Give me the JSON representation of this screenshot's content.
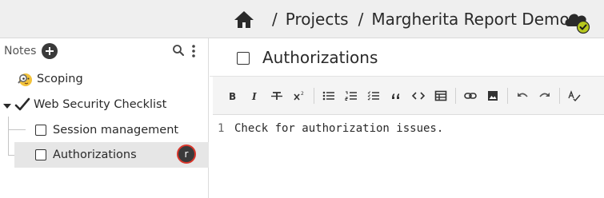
{
  "header": {
    "breadcrumb_sep": "/",
    "breadcrumbs": [
      {
        "label": "Projects"
      },
      {
        "label": "Margherita Report Demo"
      }
    ],
    "sync_status_icon": "cloud-check-icon"
  },
  "sidebar": {
    "title": "Notes",
    "items": [
      {
        "label": "Scoping",
        "icon": "magnifier-emoji-icon"
      },
      {
        "label": "Web Security Checklist",
        "icon": "checkmark-icon",
        "expanded": true
      },
      {
        "label": "Session management",
        "checked": false
      },
      {
        "label": "Authorizations",
        "checked": false,
        "selected": true,
        "user_badge": "r"
      }
    ]
  },
  "note": {
    "title": "Authorizations",
    "checked": false
  },
  "toolbar": {
    "buttons": [
      "bold",
      "italic",
      "strikethrough",
      "superscript",
      "bullet-list",
      "numbered-list",
      "task-list",
      "quote",
      "code",
      "table",
      "link",
      "image",
      "undo",
      "redo",
      "spellcheck"
    ]
  },
  "editor": {
    "lines": [
      {
        "number": "1",
        "text": "Check for authorization issues."
      }
    ]
  },
  "colors": {
    "topbar_bg": "#efefef",
    "selected_row_bg": "#e6e6e6",
    "avatar_ring": "#d9362b",
    "sync_check": "#b7c81e"
  }
}
